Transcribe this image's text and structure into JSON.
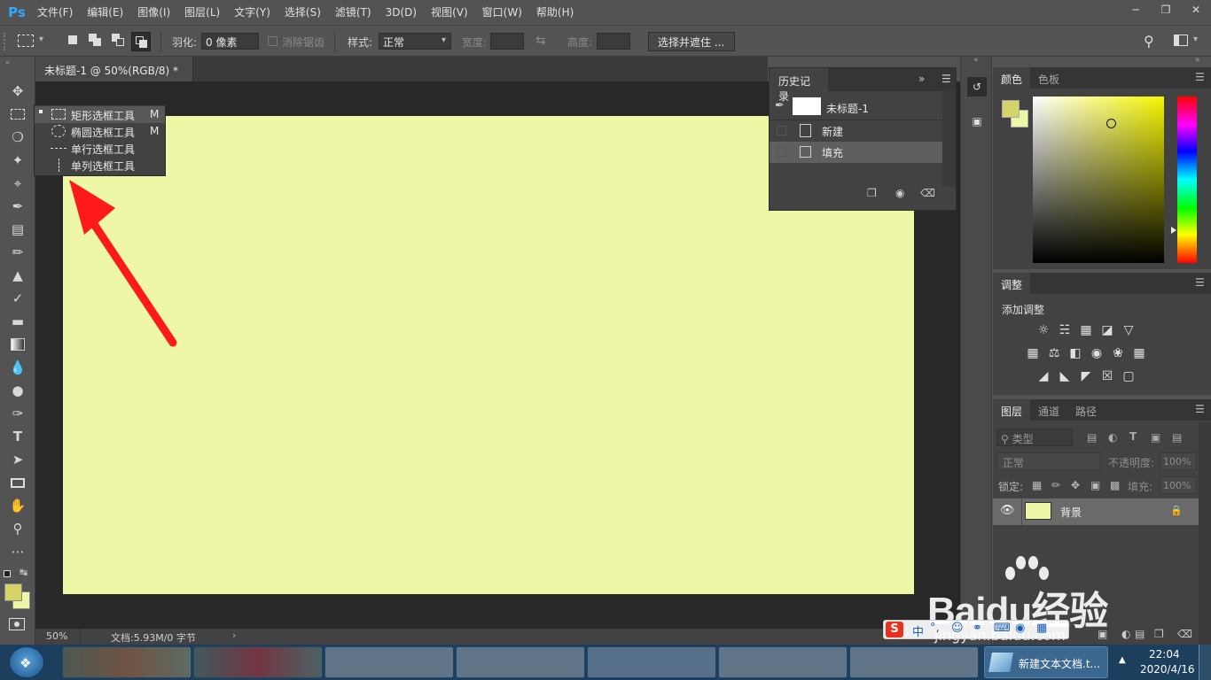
{
  "app": {
    "logo": "Ps"
  },
  "menu": [
    "文件(F)",
    "编辑(E)",
    "图像(I)",
    "图层(L)",
    "文字(Y)",
    "选择(S)",
    "滤镜(T)",
    "3D(D)",
    "视图(V)",
    "窗口(W)",
    "帮助(H)"
  ],
  "options": {
    "feather_label": "羽化:",
    "feather_value": "0 像素",
    "antialias_label": "消除锯齿",
    "style_label": "样式:",
    "style_value": "正常",
    "width_label": "宽度:",
    "height_label": "高度:",
    "select_mask_button": "选择并遮住 ..."
  },
  "document": {
    "tab_title": "未标题-1 @ 50%(RGB/8) *",
    "canvas_color": "#eef7a5",
    "zoom": "50%",
    "doc_info": "文档:5.93M/0 字节"
  },
  "flyout": {
    "items": [
      {
        "label": "矩形选框工具",
        "shortcut": "M",
        "icon": "rect-marquee-icon"
      },
      {
        "label": "椭圆选框工具",
        "shortcut": "M",
        "icon": "ellipse-marquee-icon"
      },
      {
        "label": "单行选框工具",
        "shortcut": "",
        "icon": "single-row-marquee-icon"
      },
      {
        "label": "单列选框工具",
        "shortcut": "",
        "icon": "single-column-marquee-icon"
      }
    ]
  },
  "history": {
    "title": "历史记录",
    "snapshot": "未标题-1",
    "items": [
      "新建",
      "填充"
    ]
  },
  "color_panel": {
    "tabs": [
      "颜色",
      "色板"
    ],
    "foreground": "#d4d46a",
    "background": "#eef7a5"
  },
  "adjust_panel": {
    "tab": "调整",
    "heading": "添加调整"
  },
  "layers_panel": {
    "tabs": [
      "图层",
      "通道",
      "路径"
    ],
    "filter_kind": "类型",
    "blend_mode": "正常",
    "opacity_label": "不透明度:",
    "opacity_value": "100%",
    "lock_label": "锁定:",
    "fill_label": "填充:",
    "fill_value": "100%",
    "layers": [
      {
        "name": "背景",
        "swatch": "#eef7a5"
      }
    ]
  },
  "watermark": {
    "brand": "Baidu经验",
    "url": "jingyan.baidu.com"
  },
  "ime": {
    "mode": "中"
  },
  "taskbar": {
    "active_item": "新建文本文档.t...",
    "time": "22:04",
    "date": "2020/4/16"
  },
  "colors": {
    "arrow": "#ff1a1a",
    "accent": "#31a8ff"
  }
}
